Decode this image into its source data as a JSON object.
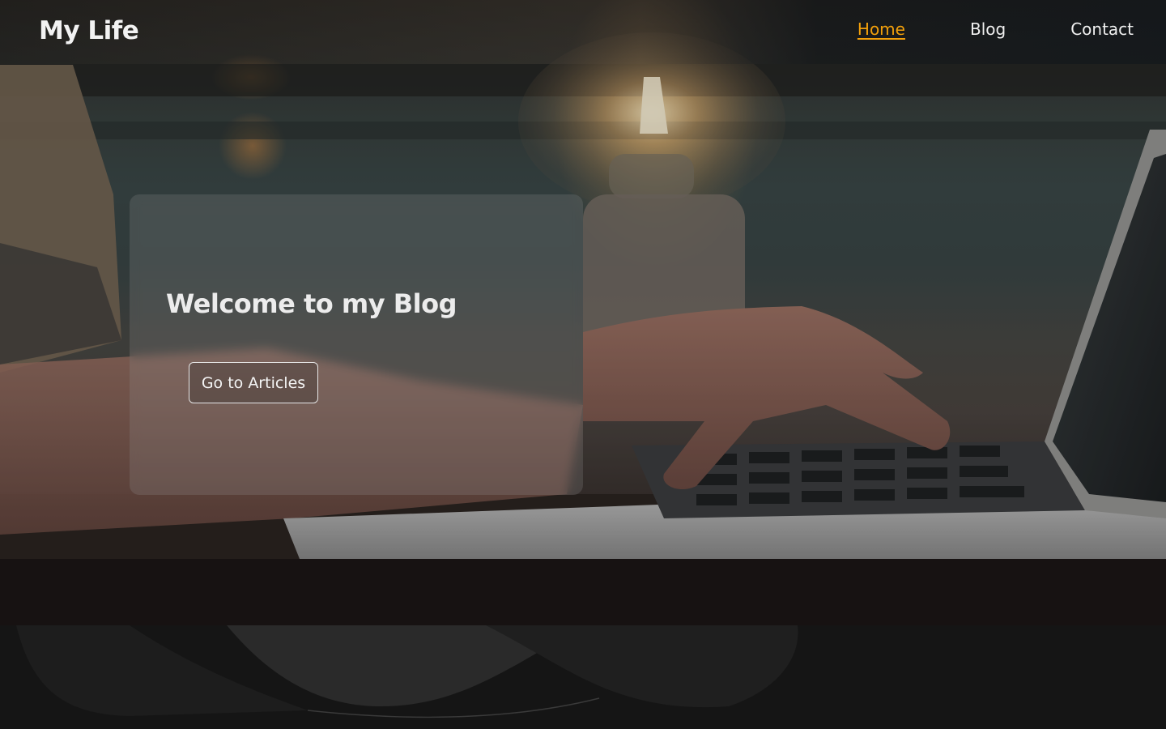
{
  "navbar": {
    "brand": "My Life",
    "links": [
      {
        "label": "Home",
        "active": true
      },
      {
        "label": "Blog",
        "active": false
      },
      {
        "label": "Contact",
        "active": false
      }
    ]
  },
  "hero": {
    "title": "Welcome to my Blog",
    "button_label": "Go to Articles"
  },
  "colors": {
    "accent": "#f2a00b",
    "text": "#f0f0f0",
    "background": "#151515"
  }
}
